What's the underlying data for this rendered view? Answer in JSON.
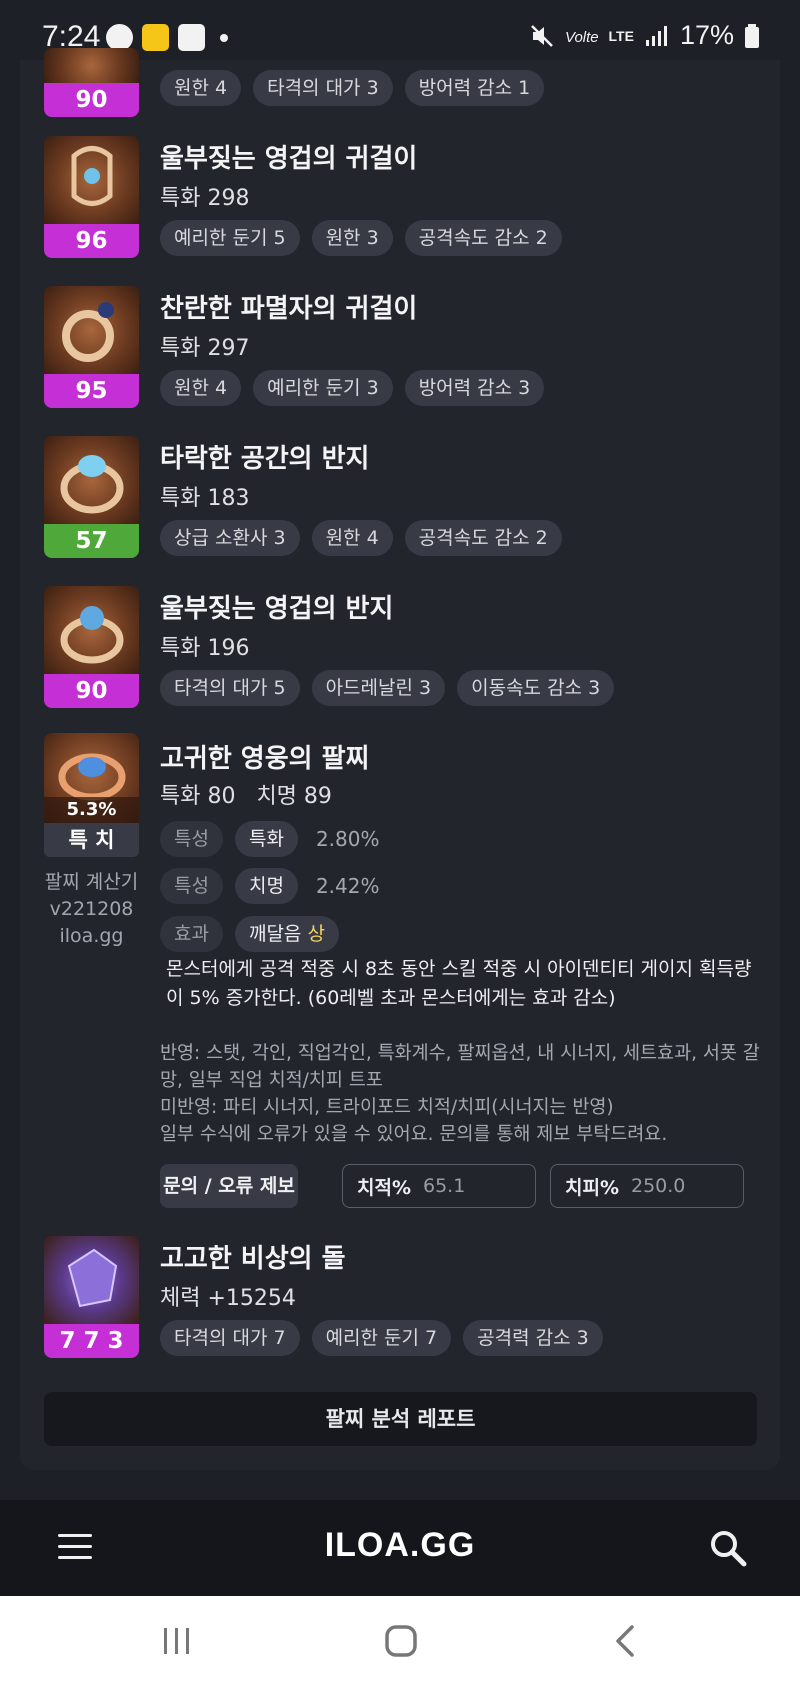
{
  "status_bar": {
    "time": "7:24",
    "battery": "17%",
    "network_label": "LTE"
  },
  "partial_item": {
    "level": "90",
    "tags": [
      "원한 4",
      "타격의 대가 3",
      "방어력 감소 1"
    ]
  },
  "items": [
    {
      "title": "울부짖는 영겁의 귀걸이",
      "stat": "특화 298",
      "level": "96",
      "level_color": "#c42fd6",
      "tags": [
        "예리한 둔기 5",
        "원한 3",
        "공격속도 감소 2"
      ]
    },
    {
      "title": "찬란한 파멸자의 귀걸이",
      "stat": "특화 297",
      "level": "95",
      "level_color": "#c42fd6",
      "tags": [
        "원한 4",
        "예리한 둔기 3",
        "방어력 감소 3"
      ]
    },
    {
      "title": "타락한 공간의 반지",
      "stat": "특화 183",
      "level": "57",
      "level_color": "#4ea83a",
      "tags": [
        "상급 소환사 3",
        "원한 4",
        "공격속도 감소 2"
      ]
    },
    {
      "title": "울부짖는 영겁의 반지",
      "stat": "특화 196",
      "level": "90",
      "level_color": "#c42fd6",
      "tags": [
        "타격의 대가 5",
        "아드레날린 3",
        "이동속도 감소 3"
      ]
    }
  ],
  "bracelet": {
    "title": "고귀한 영웅의 팔찌",
    "stat": "특화 80   치명 89",
    "percent": "5.3%",
    "stat_short": "특 치",
    "calc_lines": [
      "팔찌 계산기",
      "v221208",
      "iloa.gg"
    ],
    "rows": [
      {
        "kind": "특성",
        "name": "특화",
        "value": "2.80%"
      },
      {
        "kind": "특성",
        "name": "치명",
        "value": "2.42%"
      }
    ],
    "effect": {
      "kind": "효과",
      "name": "깨달음",
      "grade": "상"
    },
    "description": "몬스터에게 공격 적중 시 8초 동안 스킬 적중 시 아이덴티티 게이지 획득량이 5% 증가한다. (60레벨 초과 몬스터에게는 효과 감소)",
    "note_lines": [
      "반영: 스탯, 각인, 직업각인, 특화계수, 팔찌옵션, 내 시너지, 세트효과, 서폿 갈망, 일부 직업 치적/치피 트포",
      "미반영: 파티 시너지, 트라이포드 치적/치피(시너지는 반영)",
      "일부 수식에 오류가 있을 수 있어요. 문의를 통해 제보 부탁드려요."
    ],
    "report_button": "문의 / 오류 제보",
    "crit_rate_label": "치적%",
    "crit_rate_value": "65.1",
    "crit_dmg_label": "치피%",
    "crit_dmg_value": "250.0"
  },
  "stone": {
    "title": "고고한 비상의 돌",
    "stat": "체력 +15254",
    "level": "7 7 3",
    "tags": [
      "타격의 대가 7",
      "예리한 둔기 7",
      "공격력 감소 3"
    ]
  },
  "analysis_button": "팔찌 분석 레포트",
  "app_bar": {
    "logo": "ILOA.GG"
  }
}
